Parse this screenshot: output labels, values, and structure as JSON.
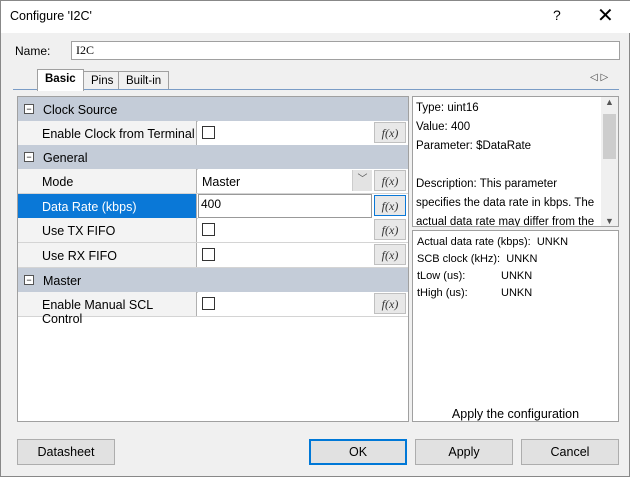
{
  "window": {
    "title": "Configure 'I2C'",
    "help": "?",
    "close": "✕"
  },
  "name": {
    "label": "Name:",
    "value": "I2C"
  },
  "tabs": [
    {
      "label": "Basic"
    },
    {
      "label": "Pins"
    },
    {
      "label": "Built-in"
    }
  ],
  "tab_arrows": "◁ ▷",
  "grid": {
    "fx": "f(x)",
    "cat_clock": "Clock Source",
    "enable_clock": {
      "label": "Enable Clock from Terminal",
      "checked": false
    },
    "cat_general": "General",
    "mode": {
      "label": "Mode",
      "value": "Master"
    },
    "data_rate": {
      "label": "Data Rate (kbps)",
      "value": "400"
    },
    "tx_fifo": {
      "label": "Use TX FIFO",
      "checked": false
    },
    "rx_fifo": {
      "label": "Use RX FIFO",
      "checked": false
    },
    "cat_master": "Master",
    "manual_scl": {
      "label": "Enable Manual SCL Control",
      "checked": false
    }
  },
  "info": {
    "type": "Type: uint16",
    "value": "Value: 400",
    "parameter": "Parameter: $DataRate",
    "description": "Description: This parameter specifies the data rate in kbps. The actual data rate may differ from the"
  },
  "calc": [
    {
      "label": "Actual data rate (kbps):",
      "value": "UNKN"
    },
    {
      "label": "SCB clock (kHz):",
      "value": "UNKN"
    },
    {
      "label": "tLow (us):",
      "value": "UNKN"
    },
    {
      "label": "tHigh (us):",
      "value": "UNKN"
    }
  ],
  "apply_text": "Apply the configuration",
  "buttons": {
    "datasheet": "Datasheet",
    "ok": "OK",
    "apply": "Apply",
    "cancel": "Cancel"
  },
  "colors": {
    "selection": "#0a78d7",
    "category": "#c4ccd8"
  }
}
